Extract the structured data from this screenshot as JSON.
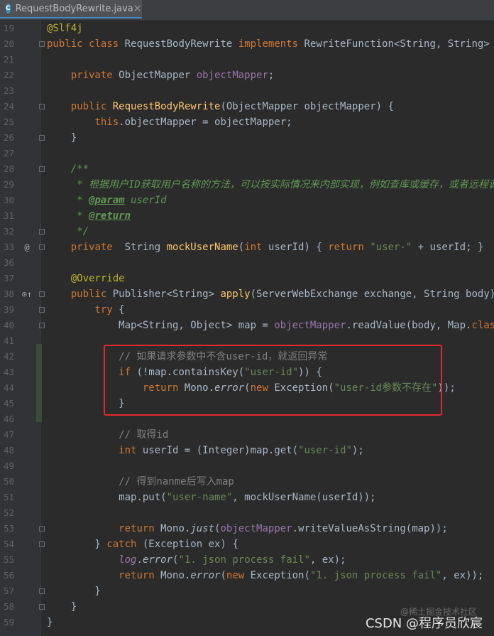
{
  "tab": {
    "label": "RequestBodyRewrite.java",
    "icon": "java-class-icon",
    "icon_letter": "C"
  },
  "lines": [
    {
      "n": "19",
      "t": "@Slf4j"
    },
    {
      "n": "20",
      "t": "public class RequestBodyRewrite implements RewriteFunction<String, String> {"
    },
    {
      "n": "21",
      "t": ""
    },
    {
      "n": "22",
      "t": "    private ObjectMapper objectMapper;"
    },
    {
      "n": "23",
      "t": ""
    },
    {
      "n": "24",
      "t": "    public RequestBodyRewrite(ObjectMapper objectMapper) {"
    },
    {
      "n": "25",
      "t": "        this.objectMapper = objectMapper;"
    },
    {
      "n": "26",
      "t": "    }"
    },
    {
      "n": "27",
      "t": ""
    },
    {
      "n": "28",
      "t": "    /**"
    },
    {
      "n": "29",
      "t": "     * 根据用户ID获取用户名称的方法，可以按实际情况来内部实现，例如查库或缓存，或者远程调用"
    },
    {
      "n": "30",
      "t": "     * @param userId"
    },
    {
      "n": "31",
      "t": "     * @return"
    },
    {
      "n": "32",
      "t": "     */"
    },
    {
      "n": "33",
      "t": "    private  String mockUserName(int userId) { return \"user-\" + userId; }"
    },
    {
      "n": "36",
      "t": ""
    },
    {
      "n": "37",
      "t": "    @Override"
    },
    {
      "n": "38",
      "t": "    public Publisher<String> apply(ServerWebExchange exchange, String body) {"
    },
    {
      "n": "39",
      "t": "        try {"
    },
    {
      "n": "40",
      "t": "            Map<String, Object> map = objectMapper.readValue(body, Map.class);"
    },
    {
      "n": "41",
      "t": ""
    },
    {
      "n": "42",
      "t": "            // 如果请求参数中不含user-id，就返回异常"
    },
    {
      "n": "43",
      "t": "            if (!map.containsKey(\"user-id\")) {"
    },
    {
      "n": "44",
      "t": "                return Mono.error(new Exception(\"user-id参数不存在\"));"
    },
    {
      "n": "45",
      "t": "            }"
    },
    {
      "n": "46",
      "t": ""
    },
    {
      "n": "47",
      "t": "            // 取得id"
    },
    {
      "n": "48",
      "t": "            int userId = (Integer)map.get(\"user-id\");"
    },
    {
      "n": "49",
      "t": ""
    },
    {
      "n": "50",
      "t": "            // 得到nanme后写入map"
    },
    {
      "n": "51",
      "t": "            map.put(\"user-name\", mockUserName(userId));"
    },
    {
      "n": "52",
      "t": ""
    },
    {
      "n": "53",
      "t": "            return Mono.just(objectMapper.writeValueAsString(map));"
    },
    {
      "n": "54",
      "t": "        } catch (Exception ex) {"
    },
    {
      "n": "55",
      "t": "            log.error(\"1. json process fail\", ex);"
    },
    {
      "n": "56",
      "t": "            return Mono.error(new Exception(\"1. json process fail\", ex));"
    },
    {
      "n": "57",
      "t": "        }"
    },
    {
      "n": "58",
      "t": "    }"
    },
    {
      "n": "59",
      "t": "}"
    }
  ],
  "gutter_markers": [
    {
      "line": "33",
      "symbol": "@"
    },
    {
      "line": "38",
      "symbol": "⊙↑"
    }
  ],
  "watermark": "CSDN @程序员欣宸",
  "watermark_sub": "@稀土掘金技术社区",
  "colors": {
    "background": "#2b2b2b",
    "keyword": "#cc7832",
    "string": "#6a8759",
    "comment": "#808080",
    "highlight_box": "#e0292e"
  }
}
